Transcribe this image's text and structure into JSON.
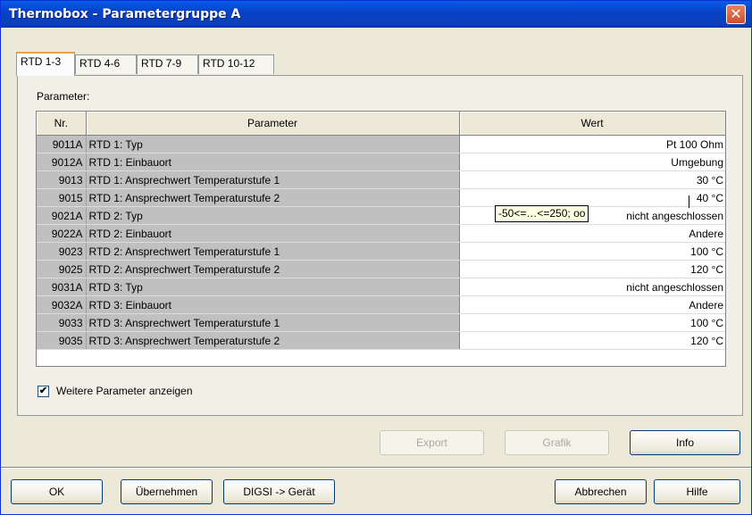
{
  "window": {
    "title": "Thermobox - Parametergruppe A",
    "close_glyph": "✕"
  },
  "tabs": [
    {
      "label": "RTD 1-3",
      "active": true
    },
    {
      "label": "RTD 4-6",
      "active": false
    },
    {
      "label": "RTD 7-9",
      "active": false
    },
    {
      "label": "RTD 10-12",
      "active": false
    }
  ],
  "parameter_section_label": "Parameter:",
  "table": {
    "headers": {
      "nr": "Nr.",
      "parameter": "Parameter",
      "wert": "Wert"
    },
    "rows": [
      {
        "nr": "9011A",
        "parameter": "RTD 1: Typ",
        "wert": "Pt 100 Ohm"
      },
      {
        "nr": "9012A",
        "parameter": "RTD 1: Einbauort",
        "wert": "Umgebung"
      },
      {
        "nr": "9013",
        "parameter": "RTD 1: Ansprechwert Temperaturstufe 1",
        "wert": "30 °C"
      },
      {
        "nr": "9015",
        "parameter": "RTD 1: Ansprechwert Temperaturstufe 2",
        "wert": "40 °C"
      },
      {
        "nr": "9021A",
        "parameter": "RTD 2: Typ",
        "wert": "nicht angeschlossen"
      },
      {
        "nr": "9022A",
        "parameter": "RTD 2: Einbauort",
        "wert": "Andere"
      },
      {
        "nr": "9023",
        "parameter": "RTD 2: Ansprechwert Temperaturstufe 1",
        "wert": "100 °C"
      },
      {
        "nr": "9025",
        "parameter": "RTD 2: Ansprechwert Temperaturstufe 2",
        "wert": "120 °C"
      },
      {
        "nr": "9031A",
        "parameter": "RTD 3: Typ",
        "wert": "nicht angeschlossen"
      },
      {
        "nr": "9032A",
        "parameter": "RTD 3: Einbauort",
        "wert": "Andere"
      },
      {
        "nr": "9033",
        "parameter": "RTD 3: Ansprechwert Temperaturstufe 1",
        "wert": "100 °C"
      },
      {
        "nr": "9035",
        "parameter": "RTD 3: Ansprechwert Temperaturstufe 2",
        "wert": "120 °C"
      }
    ]
  },
  "tooltip": "-50<=…<=250; oo",
  "checkbox": {
    "label": "Weitere Parameter anzeigen",
    "checked": true,
    "check_glyph": "✔"
  },
  "buttons": {
    "export": "Export",
    "grafik": "Grafik",
    "info": "Info",
    "ok": "OK",
    "uebernehmen": "Übernehmen",
    "digsi": "DIGSI -> Gerät",
    "abbrechen": "Abbrechen",
    "hilfe": "Hilfe"
  }
}
